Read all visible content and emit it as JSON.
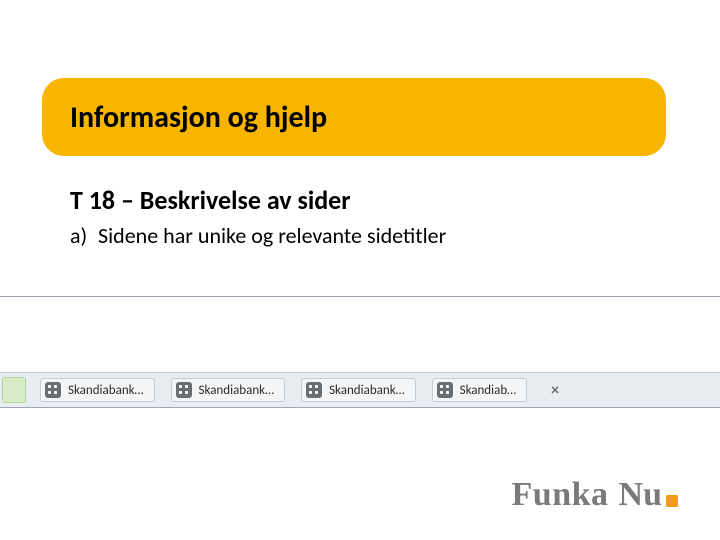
{
  "title": "Informasjon og hjelp",
  "subtitle": "T 18 – Beskrivelse av sider",
  "bullet": {
    "marker": "a)",
    "text": "Sidene har unike og relevante sidetitler"
  },
  "tabs": [
    {
      "label": "Skandiabank…"
    },
    {
      "label": "Skandiabank…"
    },
    {
      "label": "Skandiabank…"
    },
    {
      "label": "Skandiab…"
    }
  ],
  "close_glyph": "×",
  "logo": {
    "word1": "Funka",
    "word2": "Nu"
  }
}
